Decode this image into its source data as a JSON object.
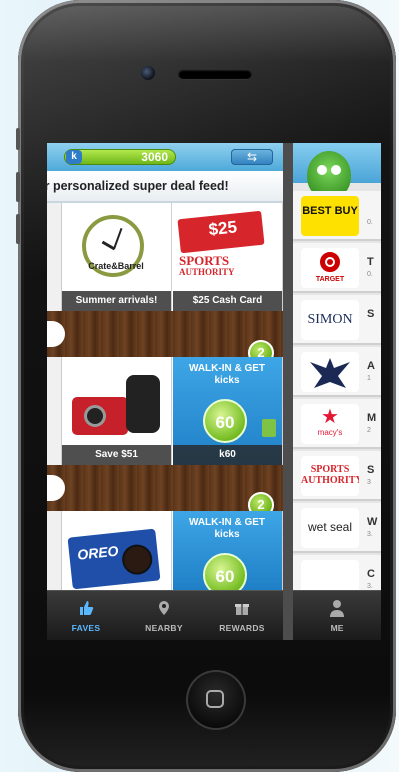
{
  "status": {
    "kicks_count": "3060",
    "kicks_logo": "k"
  },
  "banner": {
    "text": "ur personalized super deal feed!"
  },
  "feed": {
    "row1": [
      {
        "caption": "Summer arrivals!",
        "brand": "Crate&Barrel"
      },
      {
        "caption": "$25 Cash Card",
        "brand_line1": "SPORTS",
        "brand_line2": "AUTHORITY",
        "card_value": "$25"
      }
    ],
    "badge1": "2",
    "row2": [
      {
        "caption": "Save $51"
      },
      {
        "caption": "k60",
        "headline": "WALK-IN & GET",
        "sub": "kicks",
        "kicks": "60"
      }
    ],
    "badge2": "2",
    "row3": [
      {
        "brand": "OREO"
      },
      {
        "headline": "WALK-IN & GET",
        "sub": "kicks",
        "kicks": "60"
      }
    ]
  },
  "tabs": [
    {
      "label": "FAVES",
      "icon": "thumbs-up-icon",
      "active": true
    },
    {
      "label": "NEARBY",
      "icon": "map-pin-icon",
      "active": false
    },
    {
      "label": "REWARDS",
      "icon": "gift-icon",
      "active": false
    }
  ],
  "right_panel": {
    "me_label": "ME",
    "stores": [
      {
        "name": "BEST BUY",
        "letter": "",
        "sub": "0."
      },
      {
        "name": "TARGET",
        "letter": "T",
        "sub": "0."
      },
      {
        "name": "SIMON",
        "letter": "S",
        "sub": ""
      },
      {
        "name": "American Eagle",
        "letter": "A",
        "sub": "1"
      },
      {
        "name": "macy's",
        "letter": "M",
        "sub": "2"
      },
      {
        "name": "SPORTS AUTHORITY",
        "letter": "S",
        "sub": "3"
      },
      {
        "name": "wet seal",
        "letter": "W",
        "sub": "3."
      },
      {
        "name": "",
        "letter": "C",
        "sub": "3."
      }
    ]
  },
  "colors": {
    "accent": "#4aa5d7",
    "kicks_green": "#6db21a",
    "active_tab": "#5bb8ff"
  }
}
